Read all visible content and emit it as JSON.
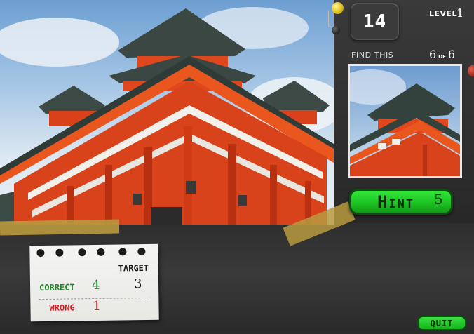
{
  "timer": {
    "value": "14"
  },
  "level": {
    "label": "LEVEL",
    "value": "1"
  },
  "find": {
    "label": "FIND THIS",
    "found": "6",
    "of_label": "of",
    "total": "6"
  },
  "hint": {
    "label": "Hint",
    "count": "5"
  },
  "score": {
    "target_label": "TARGET",
    "target_value": "3",
    "correct_label": "CORRECT",
    "correct_value": "4",
    "wrong_label": "WRONG",
    "wrong_value": "1"
  },
  "quit": {
    "label": "QUIT"
  },
  "colors": {
    "button_green": "#1cc423",
    "correct_green": "#21862a",
    "wrong_red": "#d62020",
    "pagoda_red": "#e0471d"
  }
}
